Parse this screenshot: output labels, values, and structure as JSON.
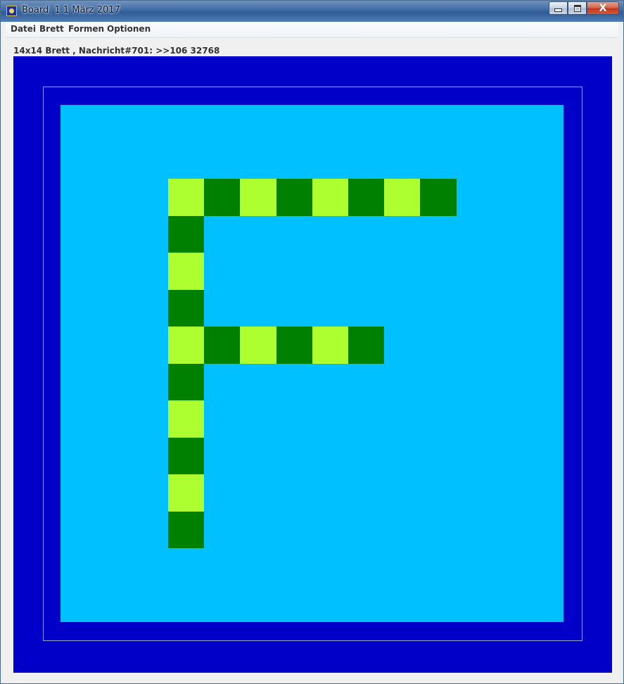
{
  "window": {
    "title": "Board, 1.1 März 2017",
    "app_icon": "board-app-icon",
    "minimize_icon": "minimize-icon",
    "maximize_icon": "maximize-icon",
    "close_icon": "close-icon",
    "close_glyph": "X"
  },
  "menu": {
    "items": [
      {
        "label": "Datei"
      },
      {
        "label": "Brett"
      },
      {
        "label": "Formen"
      },
      {
        "label": "Optionen"
      }
    ]
  },
  "status": {
    "text": "14x14 Brett , Nachricht#701: >>106 32768"
  },
  "board": {
    "grid_size": 14,
    "colors": {
      "outer": "#0000c8",
      "field": "#00c0ff",
      "light_cell": "#adff2f",
      "dark_cell": "#008000"
    },
    "cells": [
      {
        "col": 0,
        "row": 0,
        "color": "light"
      },
      {
        "col": 1,
        "row": 0,
        "color": "dark"
      },
      {
        "col": 2,
        "row": 0,
        "color": "light"
      },
      {
        "col": 3,
        "row": 0,
        "color": "dark"
      },
      {
        "col": 4,
        "row": 0,
        "color": "light"
      },
      {
        "col": 5,
        "row": 0,
        "color": "dark"
      },
      {
        "col": 6,
        "row": 0,
        "color": "light"
      },
      {
        "col": 7,
        "row": 0,
        "color": "dark"
      },
      {
        "col": 0,
        "row": 1,
        "color": "dark"
      },
      {
        "col": 0,
        "row": 2,
        "color": "light"
      },
      {
        "col": 0,
        "row": 3,
        "color": "dark"
      },
      {
        "col": 0,
        "row": 4,
        "color": "light"
      },
      {
        "col": 1,
        "row": 4,
        "color": "dark"
      },
      {
        "col": 2,
        "row": 4,
        "color": "light"
      },
      {
        "col": 3,
        "row": 4,
        "color": "dark"
      },
      {
        "col": 4,
        "row": 4,
        "color": "light"
      },
      {
        "col": 5,
        "row": 4,
        "color": "dark"
      },
      {
        "col": 0,
        "row": 5,
        "color": "dark"
      },
      {
        "col": 0,
        "row": 6,
        "color": "light"
      },
      {
        "col": 0,
        "row": 7,
        "color": "dark"
      },
      {
        "col": 0,
        "row": 8,
        "color": "light"
      },
      {
        "col": 0,
        "row": 9,
        "color": "dark"
      }
    ]
  }
}
